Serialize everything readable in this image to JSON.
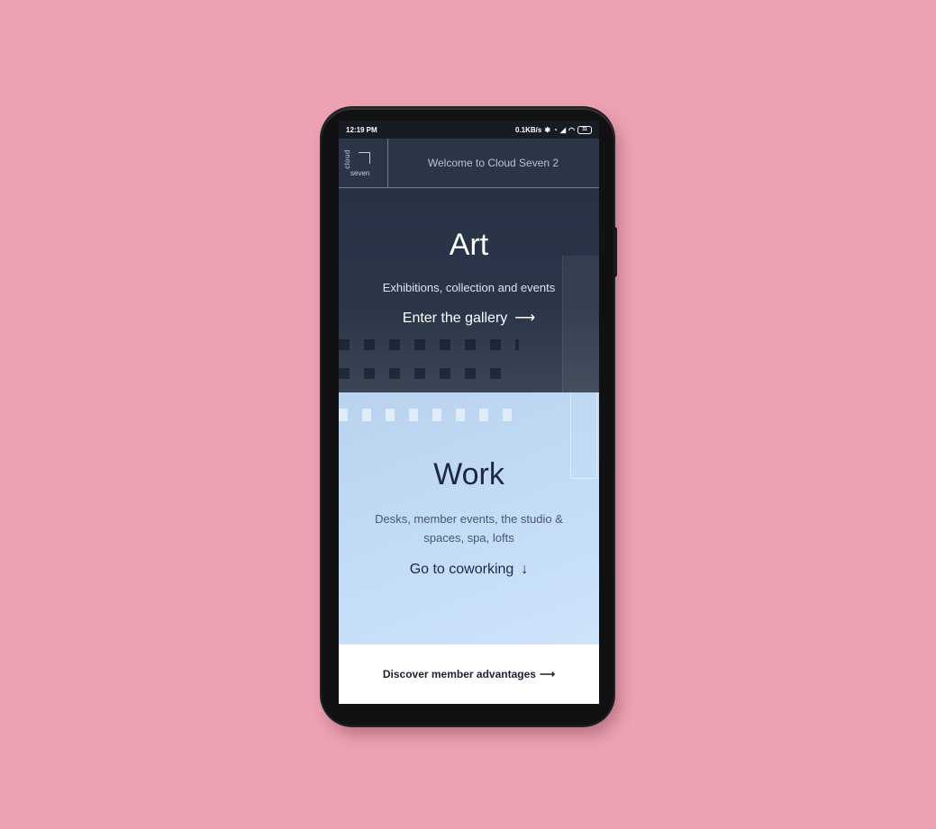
{
  "status_bar": {
    "time": "12:19 PM",
    "network_speed": "0.1KB/s",
    "battery": "31"
  },
  "header": {
    "logo_top": "cloud",
    "logo_bottom": "seven",
    "welcome": "Welcome to Cloud Seven 2"
  },
  "art": {
    "title": "Art",
    "subtitle": "Exhibitions, collection and events",
    "link": "Enter the gallery",
    "arrow": "⟶"
  },
  "work": {
    "title": "Work",
    "subtitle": "Desks, member events, the studio & spaces, spa, lofts",
    "link": "Go to coworking",
    "arrow": "↓"
  },
  "footer": {
    "link": "Discover member advantages",
    "arrow": "⟶"
  },
  "colors": {
    "background": "#eda2b3",
    "art_bg": "#2a3548",
    "work_bg": "#c3dcf8"
  }
}
